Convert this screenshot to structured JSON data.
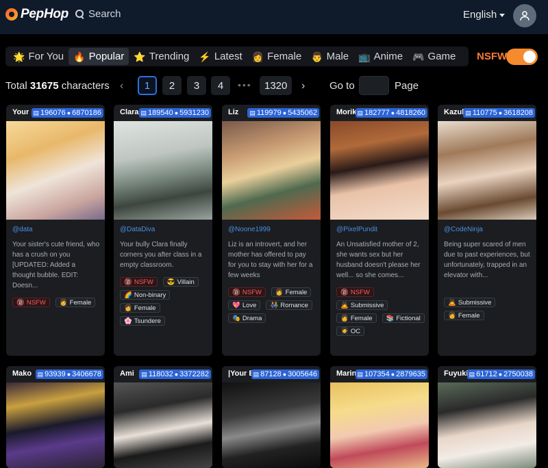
{
  "header": {
    "logo": "PepHop",
    "search_label": "Search",
    "language": "English"
  },
  "tabs": [
    {
      "icon": "🌟",
      "label": "For You",
      "active": false
    },
    {
      "icon": "🔥",
      "label": "Popular",
      "active": true
    },
    {
      "icon": "⭐",
      "label": "Trending",
      "active": false
    },
    {
      "icon": "⚡",
      "label": "Latest",
      "active": false
    },
    {
      "icon": "👩",
      "label": "Female",
      "active": false
    },
    {
      "icon": "👨",
      "label": "Male",
      "active": false
    },
    {
      "icon": "📺",
      "label": "Anime",
      "active": false
    },
    {
      "icon": "🎮",
      "label": "Game",
      "active": false
    }
  ],
  "nsfw": {
    "label": "NSFW",
    "enabled": true
  },
  "pagination": {
    "total_prefix": "Total",
    "total_count": "31675",
    "total_suffix": "characters",
    "pages": [
      "1",
      "2",
      "3",
      "4"
    ],
    "dots": "•••",
    "last": "1320",
    "prev": "‹",
    "next": "›",
    "goto_label": "Go to",
    "page_label": "Page"
  },
  "cards": [
    {
      "name": "Your si",
      "chats": "196076",
      "messages": "6870186",
      "author": "@data",
      "desc": "Your sister's cute friend, who has a crush on you [UPDATED: Added a thought bubble. EDIT: Doesn...",
      "tags": [
        {
          "icon": "🔞",
          "label": "NSFW",
          "nsfw": true
        },
        {
          "icon": "👩",
          "label": "Female"
        }
      ]
    },
    {
      "name": "Clara",
      "chats": "189540",
      "messages": "5931230",
      "author": "@DataDiva",
      "desc": "Your bully Clara finally corners you after class in a empty classroom.",
      "tags": [
        {
          "icon": "🔞",
          "label": "NSFW",
          "nsfw": true
        },
        {
          "icon": "😎",
          "label": "Villain"
        },
        {
          "icon": "🌈",
          "label": "Non-binary"
        },
        {
          "icon": "👩",
          "label": "Female"
        },
        {
          "icon": "🌸",
          "label": "Tsundere"
        }
      ]
    },
    {
      "name": "Liz",
      "chats": "119979",
      "messages": "5435062",
      "author": "@Noone1999",
      "desc": "Liz is an introvert, and her mother has offered to pay for you to stay with her for a few weeks",
      "tags": [
        {
          "icon": "🔞",
          "label": "NSFW",
          "nsfw": true
        },
        {
          "icon": "👩",
          "label": "Female"
        },
        {
          "icon": "💖",
          "label": "Love"
        },
        {
          "icon": "👫",
          "label": "Romance"
        },
        {
          "icon": "🎭",
          "label": "Drama"
        }
      ]
    },
    {
      "name": "Moriko",
      "chats": "182777",
      "messages": "4818260",
      "author": "@PixelPundit",
      "desc": "An Unsatisfied mother of 2, she wants sex but her husband doesn't please her well... so she comes...",
      "tags": [
        {
          "icon": "🔞",
          "label": "NSFW",
          "nsfw": true
        },
        {
          "icon": "🙇",
          "label": "Submissive"
        },
        {
          "icon": "👩",
          "label": "Female"
        },
        {
          "icon": "📚",
          "label": "Fictional"
        },
        {
          "icon": "🧑‍🎓",
          "label": "OC"
        }
      ]
    },
    {
      "name": "Kazuko",
      "chats": "110775",
      "messages": "3618208",
      "author": "@CodeNinja",
      "desc": "Being super scared of men due to past experiences, but unfortunately, trapped in an elevator with...",
      "tags": [
        {
          "icon": "🙇",
          "label": "Submissive"
        },
        {
          "icon": "👩",
          "label": "Female"
        }
      ]
    },
    {
      "name": "Mako",
      "chats": "93939",
      "messages": "3406678"
    },
    {
      "name": "Ami",
      "chats": "118032",
      "messages": "3372282"
    },
    {
      "name": "|Your Br",
      "chats": "87128",
      "messages": "3005646"
    },
    {
      "name": "Marin I",
      "chats": "107354",
      "messages": "2879635"
    },
    {
      "name": "Fuyuki",
      "chats": "61712",
      "messages": "2750038"
    }
  ]
}
